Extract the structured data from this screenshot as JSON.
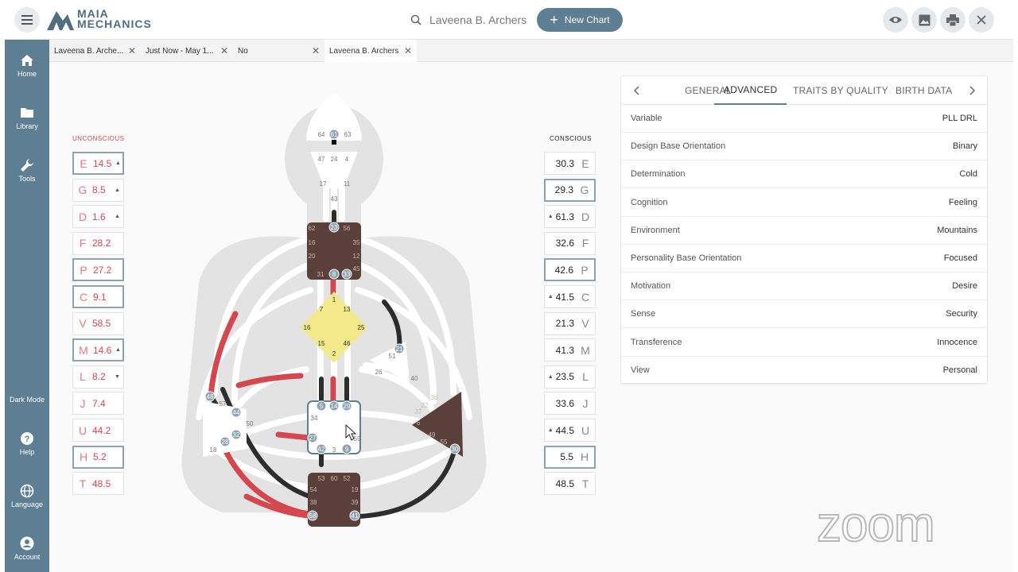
{
  "app": {
    "brand_line1": "MAIA",
    "brand_line2": "MECHANICS"
  },
  "search": {
    "value": "Laveena B. Archers"
  },
  "new_chart": {
    "label": "New Chart"
  },
  "sidebar": {
    "items": [
      {
        "label": "Home",
        "icon": "home-icon"
      },
      {
        "label": "Library",
        "icon": "folder-icon"
      },
      {
        "label": "Tools",
        "icon": "wrench-icon"
      },
      {
        "label": "Dark Mode",
        "icon": "moon-icon"
      },
      {
        "label": "Help",
        "icon": "help-icon"
      },
      {
        "label": "Language",
        "icon": "globe-icon"
      },
      {
        "label": "Account",
        "icon": "account-icon"
      }
    ]
  },
  "tabs": [
    {
      "label": "Laveena B. Arche..."
    },
    {
      "label": "Just Now - May 1..."
    },
    {
      "label": "No"
    },
    {
      "label": "Laveena B. Archers"
    }
  ],
  "chart": {
    "unconscious_title": "UNCONSCIOUS",
    "conscious_title": "CONSCIOUS",
    "unconscious": [
      {
        "letter": "E",
        "value": "14.5",
        "arrow": "▲",
        "hl": true
      },
      {
        "letter": "G",
        "value": "8.5",
        "arrow": "▲",
        "hl": false
      },
      {
        "letter": "D",
        "value": "1.6",
        "arrow": "▲",
        "hl": false
      },
      {
        "letter": "F",
        "value": "28.2",
        "arrow": "",
        "hl": false
      },
      {
        "letter": "P",
        "value": "27.2",
        "arrow": "",
        "hl": true
      },
      {
        "letter": "C",
        "value": "9.1",
        "arrow": "",
        "hl": true
      },
      {
        "letter": "V",
        "value": "58.5",
        "arrow": "",
        "hl": false
      },
      {
        "letter": "M",
        "value": "14.6",
        "arrow": "▲",
        "hl": true
      },
      {
        "letter": "L",
        "value": "8.2",
        "arrow": "▼",
        "hl": false
      },
      {
        "letter": "J",
        "value": "7.4",
        "arrow": "",
        "hl": false
      },
      {
        "letter": "U",
        "value": "44.2",
        "arrow": "",
        "hl": false
      },
      {
        "letter": "H",
        "value": "5.2",
        "arrow": "",
        "hl": true
      },
      {
        "letter": "T",
        "value": "48.5",
        "arrow": "",
        "hl": false
      }
    ],
    "conscious": [
      {
        "letter": "E",
        "value": "30.3",
        "arrow": "",
        "hl": false
      },
      {
        "letter": "G",
        "value": "29.3",
        "arrow": "",
        "hl": true
      },
      {
        "letter": "D",
        "value": "61.3",
        "arrow": "▲",
        "hl": false
      },
      {
        "letter": "F",
        "value": "32.6",
        "arrow": "",
        "hl": false
      },
      {
        "letter": "P",
        "value": "42.6",
        "arrow": "",
        "hl": true
      },
      {
        "letter": "C",
        "value": "41.5",
        "arrow": "▲",
        "hl": false
      },
      {
        "letter": "V",
        "value": "21.3",
        "arrow": "",
        "hl": false
      },
      {
        "letter": "M",
        "value": "41.3",
        "arrow": "",
        "hl": false
      },
      {
        "letter": "L",
        "value": "23.5",
        "arrow": "▲",
        "hl": false
      },
      {
        "letter": "J",
        "value": "33.6",
        "arrow": "",
        "hl": false
      },
      {
        "letter": "U",
        "value": "44.5",
        "arrow": "▲",
        "hl": false
      },
      {
        "letter": "H",
        "value": "5.5",
        "arrow": "",
        "hl": true
      },
      {
        "letter": "T",
        "value": "48.5",
        "arrow": "",
        "hl": false
      }
    ],
    "colors": {
      "defined": "#5b3f3a",
      "design": "#d4474e",
      "personality": "#2d2d2d",
      "g_center": "#f3e98a",
      "channel": "#ffffff",
      "body": "#e1e1e1"
    }
  },
  "panel": {
    "tabs": [
      "GENERAL",
      "ADVANCED",
      "TRAITS BY QUALITY",
      "BIRTH DATA"
    ],
    "active_tab": "ADVANCED",
    "rows": [
      {
        "key": "Variable",
        "value": "PLL DRL"
      },
      {
        "key": "Design Base Orientation",
        "value": "Binary"
      },
      {
        "key": "Determination",
        "value": "Cold"
      },
      {
        "key": "Cognition",
        "value": "Feeling"
      },
      {
        "key": "Environment",
        "value": "Mountains"
      },
      {
        "key": "Personality Base Orientation",
        "value": "Focused"
      },
      {
        "key": "Motivation",
        "value": "Desire"
      },
      {
        "key": "Sense",
        "value": "Security"
      },
      {
        "key": "Transference",
        "value": "Innocence"
      },
      {
        "key": "View",
        "value": "Personal"
      }
    ]
  },
  "watermark": "zoom"
}
